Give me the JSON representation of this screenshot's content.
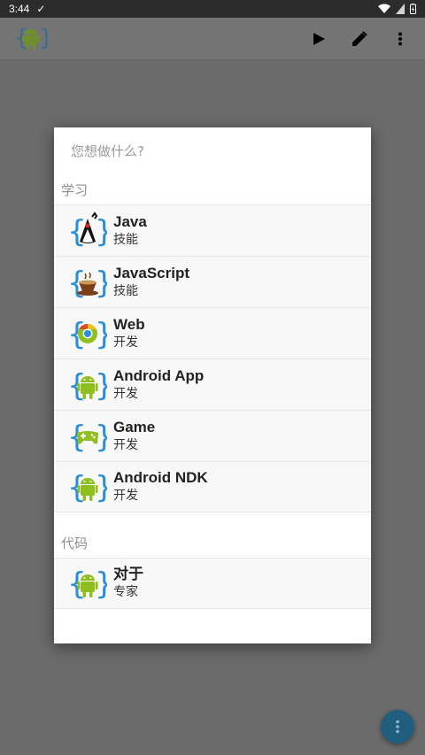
{
  "status_bar": {
    "time": "3:44",
    "check_glyph": "✓"
  },
  "app_bar": {
    "logo_icon": "aide-android-logo-icon",
    "actions": [
      {
        "name": "run-button",
        "icon": "play-icon"
      },
      {
        "name": "edit-button",
        "icon": "pencil-icon"
      },
      {
        "name": "overflow-menu-button",
        "icon": "more-vert-icon"
      }
    ]
  },
  "dialog": {
    "title": "您想做什么?",
    "sections": [
      {
        "header": "学习",
        "items": [
          {
            "title": "Java",
            "subtitle": "技能",
            "icon": "java-duke-icon"
          },
          {
            "title": "JavaScript",
            "subtitle": "技能",
            "icon": "coffee-cup-icon"
          },
          {
            "title": "Web",
            "subtitle": "开发",
            "icon": "chrome-icon"
          },
          {
            "title": "Android App",
            "subtitle": "开发",
            "icon": "android-icon"
          },
          {
            "title": "Game",
            "subtitle": "开发",
            "icon": "gamepad-icon"
          },
          {
            "title": "Android NDK",
            "subtitle": "开发",
            "icon": "android-icon"
          }
        ]
      },
      {
        "header": "代码",
        "items": [
          {
            "title": "对于",
            "subtitle": "专家",
            "icon": "android-icon"
          }
        ]
      }
    ]
  },
  "colors": {
    "accent": "#1f5f7d",
    "android_green": "#8fbf1f",
    "brace_blue": "#2a8fd6"
  }
}
